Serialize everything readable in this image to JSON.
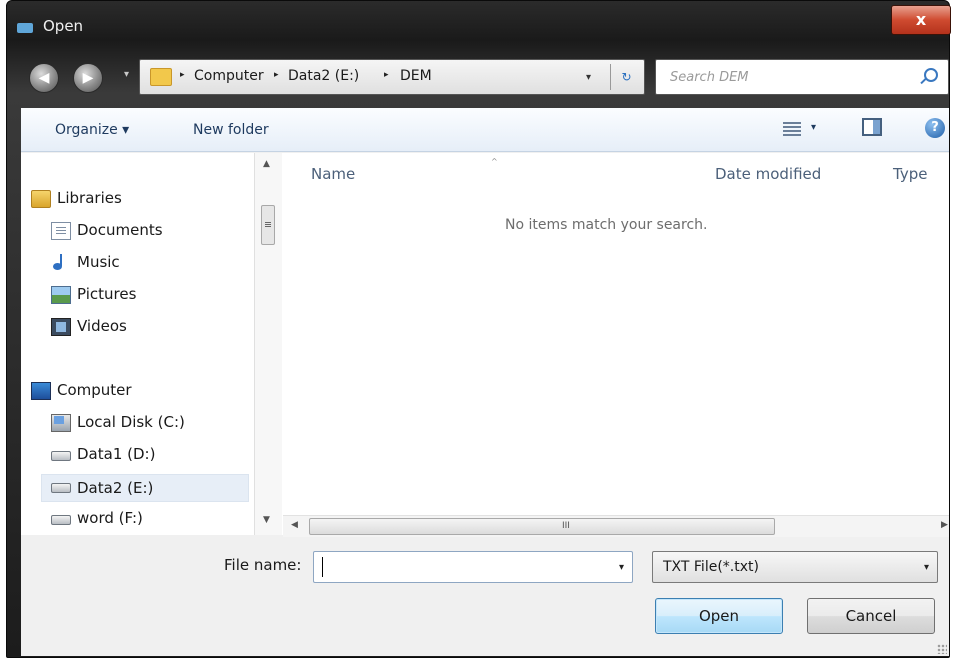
{
  "window": {
    "title": "Open",
    "close_glyph": "x"
  },
  "nav": {
    "back_glyph": "◀",
    "forward_glyph": "▶",
    "dropdown_glyph": "▾"
  },
  "address": {
    "crumbs": [
      "Computer",
      "Data2 (E:)",
      "DEM"
    ],
    "separator": "▸",
    "dropdown_glyph": "▾",
    "refresh_glyph": "↻"
  },
  "search": {
    "placeholder": "Search DEM"
  },
  "toolbar": {
    "organize_label": "Organize ▾",
    "new_folder_label": "New folder",
    "views_dropdown_glyph": "▾",
    "help_glyph": "?"
  },
  "navpane": {
    "items": [
      {
        "label": "Libraries",
        "icon": "libraries-icon"
      },
      {
        "label": "Documents",
        "icon": "documents-icon"
      },
      {
        "label": "Music",
        "icon": "music-icon"
      },
      {
        "label": "Pictures",
        "icon": "pictures-icon"
      },
      {
        "label": "Videos",
        "icon": "videos-icon"
      },
      {
        "label": "Computer",
        "icon": "computer-icon"
      },
      {
        "label": "Local Disk (C:)",
        "icon": "local-disk-icon"
      },
      {
        "label": "Data1 (D:)",
        "icon": "drive-icon"
      },
      {
        "label": "Data2 (E:)",
        "icon": "drive-icon",
        "selected": true
      },
      {
        "label": "word (F:)",
        "icon": "drive-icon"
      }
    ],
    "scroll_up_glyph": "▲",
    "scroll_down_glyph": "▼"
  },
  "filelist": {
    "columns": [
      "Name",
      "Date modified",
      "Type"
    ],
    "sort_glyph": "^",
    "empty_message": "No items match your search.",
    "hscroll": {
      "left_glyph": "◀",
      "right_glyph": "▶",
      "grip": "III"
    }
  },
  "bottom": {
    "file_name_label": "File name:",
    "file_name_value": "",
    "file_type_value": "TXT File(*.txt)",
    "dropdown_glyph": "▾",
    "open_label": "Open",
    "cancel_label": "Cancel"
  },
  "colors": {
    "frame": "#2a2a2a",
    "close": "#cf4b30",
    "toolbar_text": "#1e3a5f",
    "open_button": "#bee6fd"
  }
}
